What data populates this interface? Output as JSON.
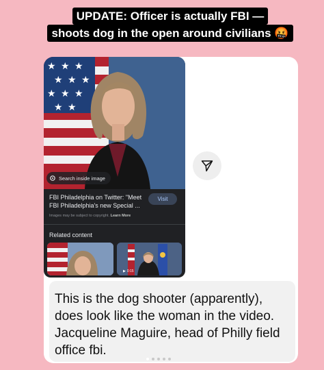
{
  "caption": {
    "line1": "UPDATE: Officer is actually FBI —",
    "line2": "shoots dog in the open around civilians 🤬"
  },
  "lens": {
    "search_chip_label": "Search inside image",
    "source_title": "FBI Philadelphia on Twitter: \"Meet FBI Philadelphia's new Special ...",
    "visit_label": "Visit",
    "copyright_notice": "Images may be subject to copyright.",
    "learn_more": "Learn More",
    "related_heading": "Related content",
    "thumb2_badge": "0:15"
  },
  "post_text": "This is the dog shooter (apparently), does look like the woman in the video. Jacqueline Maguire, head of Philly field office fbi.",
  "carousel": {
    "total": 5,
    "active_index": 0
  },
  "colors": {
    "background": "#f6b8c1",
    "lens_panel": "#202124",
    "visit_button": "#394457",
    "text_card": "#f1f1f1"
  }
}
